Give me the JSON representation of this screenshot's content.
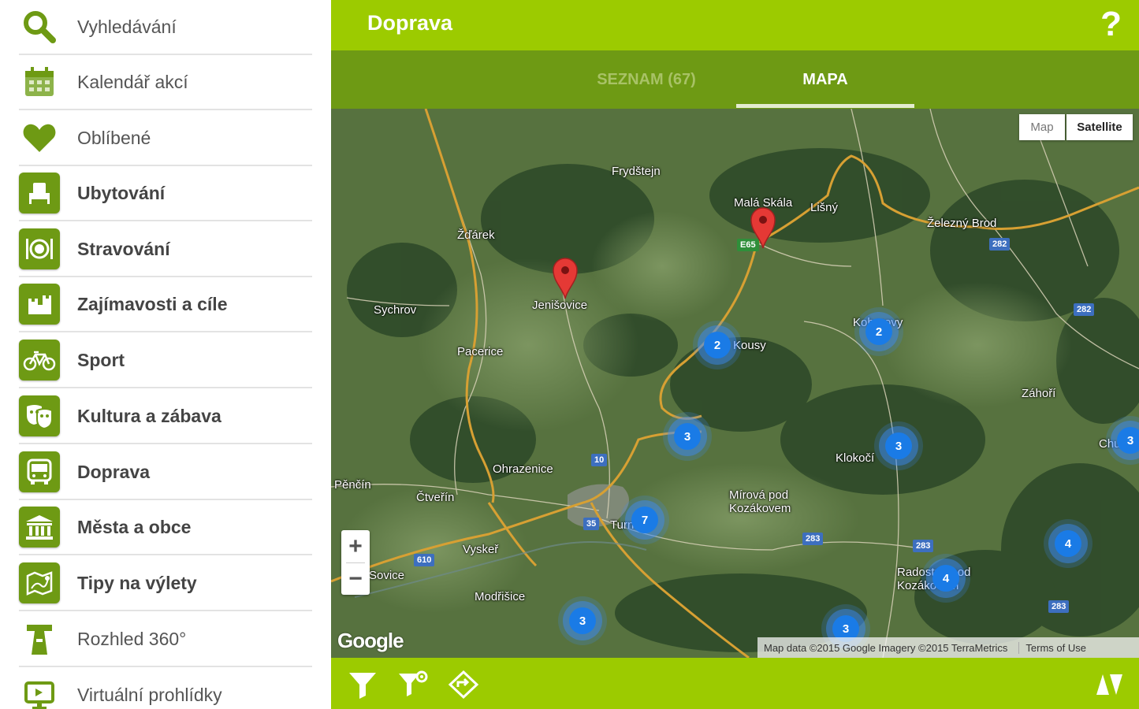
{
  "sidebar": {
    "items": [
      {
        "label": "Vyhledávání",
        "icon": "search-icon",
        "style": "plain"
      },
      {
        "label": "Kalendář akcí",
        "icon": "calendar-icon",
        "style": "plain"
      },
      {
        "label": "Oblíbené",
        "icon": "heart-icon",
        "style": "plain"
      },
      {
        "label": "Ubytování",
        "icon": "bed-icon",
        "style": "box"
      },
      {
        "label": "Stravování",
        "icon": "plate-cutlery-icon",
        "style": "box"
      },
      {
        "label": "Zajímavosti a cíle",
        "icon": "castle-icon",
        "style": "box"
      },
      {
        "label": "Sport",
        "icon": "bicycle-icon",
        "style": "box"
      },
      {
        "label": "Kultura a zábava",
        "icon": "theatre-masks-icon",
        "style": "box"
      },
      {
        "label": "Doprava",
        "icon": "bus-icon",
        "style": "box"
      },
      {
        "label": "Města a obce",
        "icon": "town-hall-icon",
        "style": "box"
      },
      {
        "label": "Tipy na výlety",
        "icon": "map-route-icon",
        "style": "box"
      },
      {
        "label": "Rozhled 360°",
        "icon": "lookout-tower-icon",
        "style": "plain"
      },
      {
        "label": "Virtuální prohlídky",
        "icon": "monitor-icon",
        "style": "plain"
      }
    ]
  },
  "header": {
    "title": "Doprava",
    "help": "?"
  },
  "tabs": {
    "list_label": "SEZNAM (67)",
    "map_label": "MAPA",
    "active": "MAPA"
  },
  "map": {
    "type_map": "Map",
    "type_satellite": "Satellite",
    "zoom_in": "+",
    "zoom_out": "−",
    "attribution": "Map data ©2015 Google Imagery ©2015 TerraMetrics",
    "terms": "Terms of Use",
    "google": "Google",
    "places": [
      "Frydštejn",
      "Malá Skála",
      "Lišný",
      "Železný Brod",
      "Žďárek",
      "Sychrov",
      "Jenišovice",
      "Pacerice",
      "Koberovy",
      "Kousy",
      "Záhoří",
      "Klokočí",
      "Chu",
      "Ohrazenice",
      "Čtveřín",
      "Pěnčín",
      "Mírová pod Kozákovem",
      "Turnov",
      "Vyskeř",
      "Modřišice",
      "Radostná pod Kozákovem",
      "Sovice"
    ],
    "road_numbers": [
      "E65",
      "282",
      "282",
      "10",
      "35",
      "283",
      "283",
      "283",
      "610",
      "282"
    ],
    "clusters": [
      "2",
      "2",
      "3",
      "3",
      "7",
      "3",
      "4",
      "4",
      "3",
      "3"
    ]
  },
  "colors": {
    "accent": "#9ccb00",
    "accent_dark": "#6e9a14",
    "cluster": "#1a7be6",
    "pin": "#e53935"
  },
  "bottombar": {
    "icons": [
      "filter-icon",
      "filter-settings-icon",
      "route-icon",
      "sort-icon"
    ]
  }
}
